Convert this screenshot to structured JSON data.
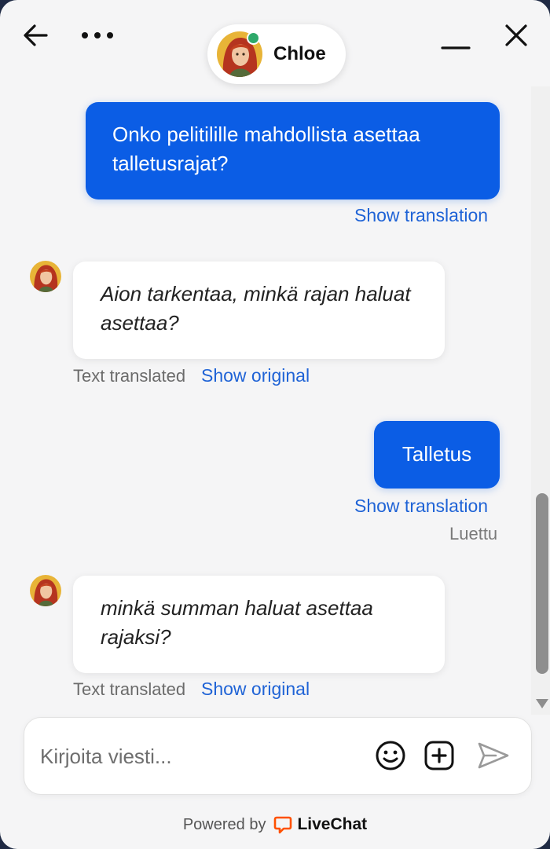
{
  "header": {
    "agent_name": "Chloe",
    "agent_status": "online",
    "status_color": "#2ea96a",
    "back_icon": "arrow-left-icon",
    "more_icon": "more-horizontal-icon",
    "minimize_icon": "minimize-icon",
    "close_icon": "close-icon"
  },
  "messages": [
    {
      "direction": "out",
      "text": "Onko pelitilille mahdollista asettaa talletusrajat?",
      "link": "Show translation"
    },
    {
      "direction": "in",
      "text": "Aion tarkentaa, minkä rajan haluat asettaa?",
      "meta": "Text translated",
      "link": "Show original"
    },
    {
      "direction": "out",
      "text": "Talletus",
      "link": "Show translation",
      "status": "Luettu"
    },
    {
      "direction": "in",
      "text": "minkä summan haluat asettaa rajaksi?",
      "meta": "Text translated",
      "link": "Show original"
    }
  ],
  "composer": {
    "placeholder": "Kirjoita viesti...",
    "value": "",
    "emoji_icon": "emoji-icon",
    "attach_icon": "add-attachment-icon",
    "send_icon": "send-icon"
  },
  "footer": {
    "powered_by": "Powered by",
    "brand": "LiveChat",
    "brand_color": "#ff5100"
  },
  "colors": {
    "accent": "#0b5de5",
    "link": "#1f63d6",
    "background": "#f5f5f6"
  }
}
